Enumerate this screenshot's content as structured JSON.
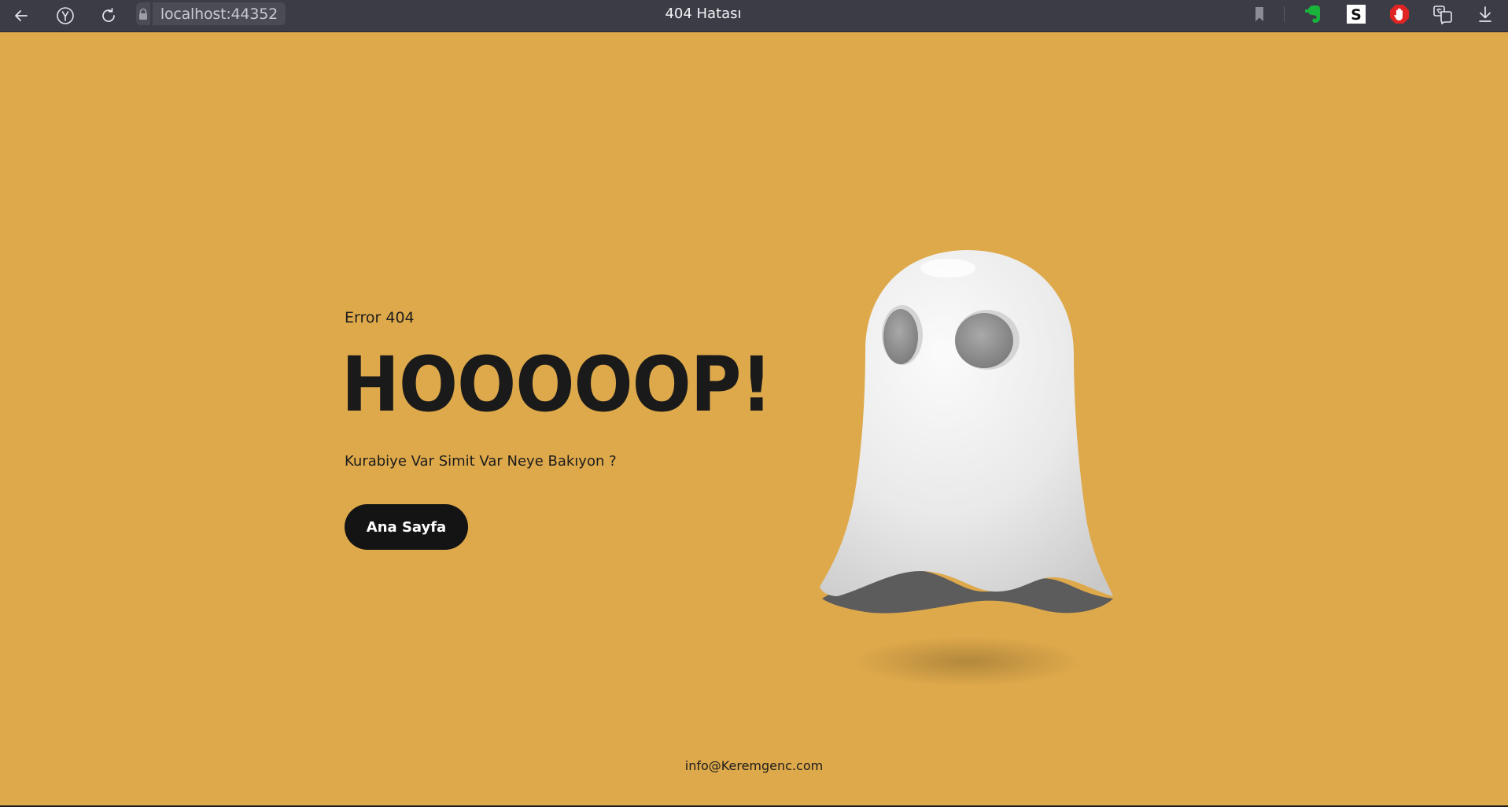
{
  "browser": {
    "url": "localhost:44352",
    "tab_title": "404 Hatası"
  },
  "page": {
    "error_label": "Error 404",
    "headline": "HOOOOOP!",
    "subtitle": "Kurabiye Var Simit Var Neye Bakıyon ?",
    "home_button_label": "Ana Sayfa",
    "footer_email": "info@Keremgenc.com"
  },
  "colors": {
    "page_background": "#dea94b",
    "chrome_background": "#3b3c45",
    "button_background": "#141414",
    "text_dark": "#1a1a1a"
  },
  "icons": {
    "back": "arrow-left-icon",
    "yandex": "yandex-y-icon",
    "reload": "reload-icon",
    "lock": "lock-icon",
    "bookmark": "bookmark-icon",
    "evernote": "evernote-icon",
    "s_extension": "s-extension-icon",
    "adblock": "adblock-hand-icon",
    "translate": "translate-icon",
    "download": "download-icon"
  }
}
